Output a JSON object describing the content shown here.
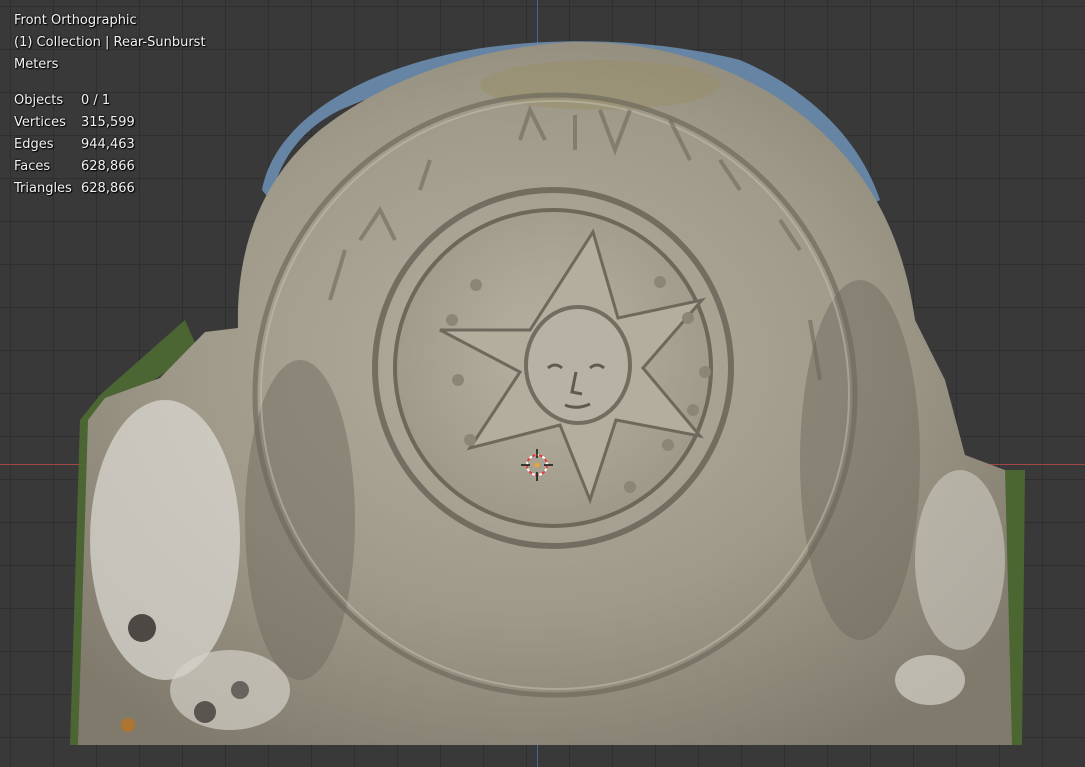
{
  "viewport": {
    "view_name": "Front Orthographic",
    "collection_info": "(1) Collection | Rear-Sunburst",
    "units": "Meters"
  },
  "stats": [
    {
      "label": "Objects",
      "value": "0 / 1"
    },
    {
      "label": "Vertices",
      "value": "315,599"
    },
    {
      "label": "Edges",
      "value": "944,463"
    },
    {
      "label": "Faces",
      "value": "628,866"
    },
    {
      "label": "Triangles",
      "value": "628,866"
    }
  ],
  "colors": {
    "grid_background": "#393939",
    "x_axis": "#a34646",
    "z_axis": "#3d6ba0",
    "stone": "#a8a397"
  },
  "icons": {
    "cursor": "3d-cursor-icon"
  }
}
